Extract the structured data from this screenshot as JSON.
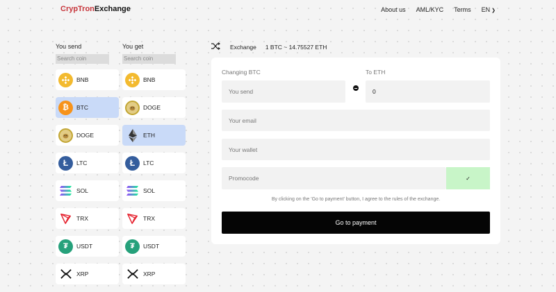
{
  "header": {
    "logo_part1": "CrypTron",
    "logo_part2": "Exchange",
    "nav": [
      "About us",
      "AML/KYC",
      "Terms"
    ],
    "lang": "EN"
  },
  "send": {
    "label": "You send",
    "placeholder": "Search coin",
    "coins": [
      {
        "label": "BNB",
        "icon": "bnb-icon"
      },
      {
        "label": "BTC",
        "icon": "btc-icon",
        "active": true
      },
      {
        "label": "DOGE",
        "icon": "doge-icon"
      },
      {
        "label": "LTC",
        "icon": "ltc-icon"
      },
      {
        "label": "SOL",
        "icon": "sol-icon"
      },
      {
        "label": "TRX",
        "icon": "trx-icon"
      },
      {
        "label": "USDT",
        "icon": "usdt-icon"
      },
      {
        "label": "XRP",
        "icon": "xrp-icon"
      }
    ]
  },
  "get": {
    "label": "You get",
    "placeholder": "Search coin",
    "coins": [
      {
        "label": "BNB",
        "icon": "bnb-icon"
      },
      {
        "label": "DOGE",
        "icon": "doge-icon"
      },
      {
        "label": "ETH",
        "icon": "eth-icon",
        "active": true
      },
      {
        "label": "LTC",
        "icon": "ltc-icon"
      },
      {
        "label": "SOL",
        "icon": "sol-icon"
      },
      {
        "label": "TRX",
        "icon": "trx-icon"
      },
      {
        "label": "USDT",
        "icon": "usdt-icon"
      },
      {
        "label": "XRP",
        "icon": "xrp-icon"
      }
    ]
  },
  "exchange": {
    "label": "Exchange",
    "rate": "1 BTC ~ 14.75527 ETH",
    "changing_label": "Changing BTC",
    "to_label": "To ETH",
    "send_placeholder": "You send",
    "get_value": "0",
    "email_placeholder": "Your email",
    "wallet_placeholder": "Your wallet",
    "promo_placeholder": "Promocode",
    "promo_check": "✓",
    "agree_text": "By clicking on the 'Go to payment' button, I agree to the rules of the exchange.",
    "pay_button": "Go to payment"
  },
  "colors": {
    "brand_red": "#c7343a",
    "active_coin": "#c9daf8",
    "promo_button": "#c8f5c8",
    "pay_button": "#050505"
  }
}
